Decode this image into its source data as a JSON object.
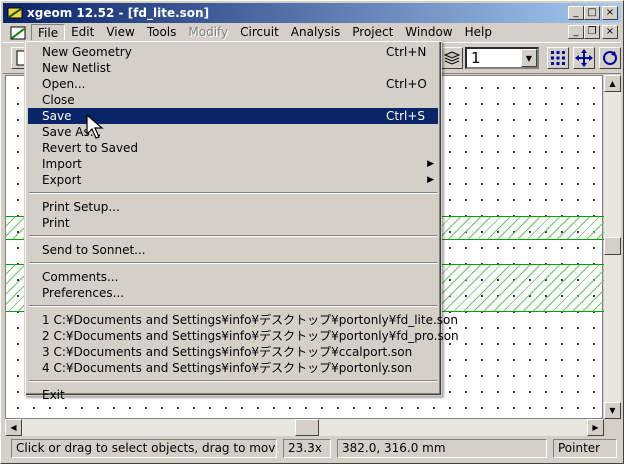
{
  "window": {
    "title": "xgeom 12.52 - [fd_lite.son]",
    "minimize": "_",
    "maximize": "□",
    "close": "×"
  },
  "mdi": {
    "minimize": "_",
    "restore": "❐",
    "close": "×"
  },
  "menubar": {
    "items": [
      {
        "label": "File"
      },
      {
        "label": "Edit"
      },
      {
        "label": "View"
      },
      {
        "label": "Tools"
      },
      {
        "label": "Modify"
      },
      {
        "label": "Circuit"
      },
      {
        "label": "Analysis"
      },
      {
        "label": "Project"
      },
      {
        "label": "Window"
      },
      {
        "label": "Help"
      }
    ]
  },
  "toolbar": {
    "level_value": "1",
    "icons": [
      "new-file-icon",
      "layers-icon",
      "grid-icon",
      "move-icon",
      "rotate-icon"
    ]
  },
  "file_menu": {
    "items": [
      {
        "label": "New Geometry",
        "shortcut": "Ctrl+N"
      },
      {
        "label": "New Netlist",
        "shortcut": ""
      },
      {
        "label": "Open...",
        "shortcut": "Ctrl+O"
      },
      {
        "label": "Close",
        "shortcut": ""
      },
      {
        "label": "Save",
        "shortcut": "Ctrl+S"
      },
      {
        "label": "Save As...",
        "shortcut": ""
      },
      {
        "label": "Revert to Saved",
        "shortcut": ""
      },
      {
        "label": "Import",
        "shortcut": ""
      },
      {
        "label": "Export",
        "shortcut": ""
      },
      {
        "label": "Print Setup...",
        "shortcut": ""
      },
      {
        "label": "Print",
        "shortcut": ""
      },
      {
        "label": "Send to Sonnet...",
        "shortcut": ""
      },
      {
        "label": "Comments...",
        "shortcut": ""
      },
      {
        "label": "Preferences...",
        "shortcut": ""
      },
      {
        "label": "1 C:¥Documents and Settings¥info¥デスクトップ¥portonly¥fd_lite.son",
        "shortcut": ""
      },
      {
        "label": "2 C:¥Documents and Settings¥info¥デスクトップ¥portonly¥fd_pro.son",
        "shortcut": ""
      },
      {
        "label": "3 C:¥Documents and Settings¥info¥デスクトップ¥ccalport.son",
        "shortcut": ""
      },
      {
        "label": "4 C:¥Documents and Settings¥info¥デスクトップ¥portonly.son",
        "shortcut": ""
      },
      {
        "label": "Exit",
        "shortcut": ""
      }
    ],
    "submenu_arrow": "▶"
  },
  "statusbar": {
    "message": "Click or drag to select objects, drag to move the",
    "zoom": "23.3x",
    "coords": "382.0, 316.0 mm",
    "mode": "Pointer"
  },
  "colors": {
    "title_active": "#0a246a",
    "selection": "#0a246a",
    "hatch": "#00a000"
  }
}
